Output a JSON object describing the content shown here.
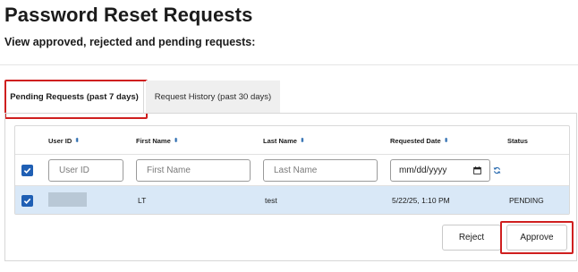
{
  "page": {
    "title": "Password Reset Requests",
    "subtitle": "View approved, rejected and pending requests:"
  },
  "tabs": [
    {
      "label": "Pending Requests (past 7 days)",
      "active": true
    },
    {
      "label": "Request History (past 30 days)",
      "active": false
    }
  ],
  "table": {
    "columns": [
      "User ID",
      "First Name",
      "Last Name",
      "Requested Date",
      "Status"
    ],
    "filters": {
      "user_id_placeholder": "User ID",
      "first_name_placeholder": "First Name",
      "last_name_placeholder": "Last Name",
      "date_placeholder": "mm/dd/yyyy"
    },
    "select_all_checked": true,
    "rows": [
      {
        "checked": true,
        "user_id": "",
        "first_name": "LT",
        "last_name": "test",
        "requested_date": "5/22/25, 1:10 PM",
        "status": "PENDING"
      }
    ]
  },
  "actions": {
    "reject_label": "Reject",
    "approve_label": "Approve"
  },
  "colors": {
    "accent": "#1f5fb4",
    "selected_row": "#d9e8f7",
    "highlight_outline": "#cf1f1f",
    "sort_icon": "#2b6cb0"
  },
  "icons": [
    "sort-icon",
    "checkbox-checked-icon",
    "calendar-icon",
    "refresh-icon"
  ]
}
